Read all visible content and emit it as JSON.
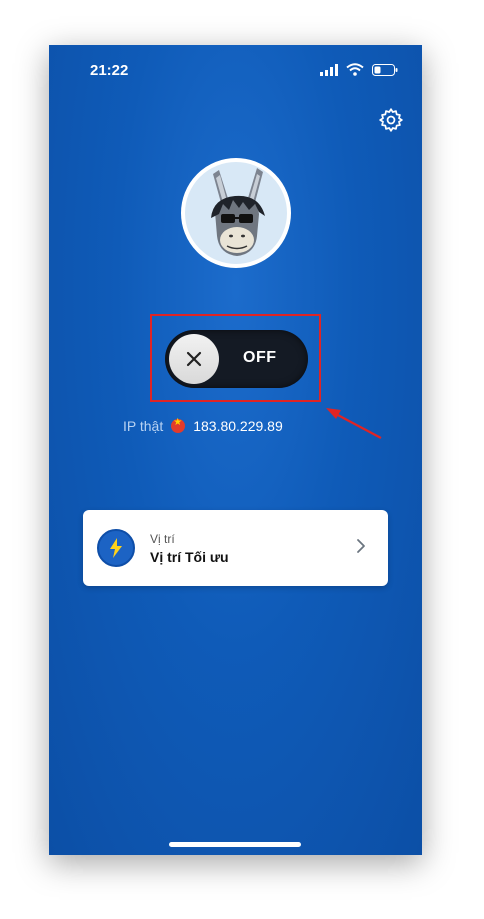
{
  "status_bar": {
    "time": "21:22"
  },
  "icons": {
    "gear": "gear-icon",
    "avatar": "donkey-avatar",
    "close": "close-icon",
    "flag": "vietnam-flag-icon",
    "lightning": "lightning-icon",
    "chevron": "chevron-right-icon"
  },
  "toggle": {
    "state_label": "OFF"
  },
  "ip": {
    "label": "IP thật",
    "address": "183.80.229.89"
  },
  "location": {
    "label": "Vị trí",
    "value": "Vị trí Tối ưu"
  },
  "colors": {
    "background": "#0f5bb8",
    "toggle_bg": "#141a24",
    "highlight": "#e02424",
    "card": "#ffffff"
  }
}
